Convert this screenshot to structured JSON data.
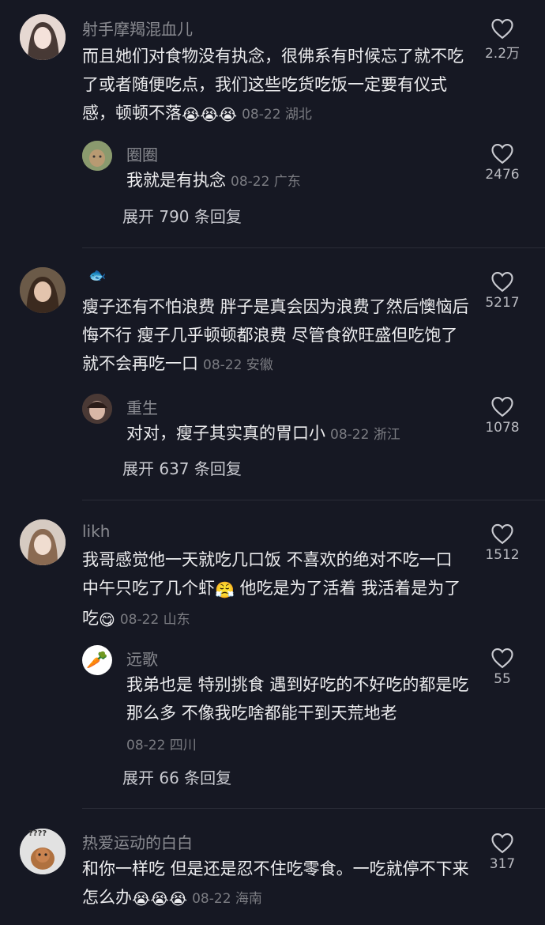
{
  "threads": [
    {
      "comment": {
        "user": "射手摩羯混血儿",
        "text": "而且她们对食物没有执念，很佛系有时候忘了就不吃了或者随便吃点，我们这些吃货吃饭一定要有仪式感，顿顿不落",
        "emojis": "😭😭😭",
        "meta": "08-22 湖北",
        "likes": "2.2万"
      },
      "reply": {
        "user": "圈圈",
        "text": "我就是有执念",
        "meta": "08-22 广东",
        "likes": "2476"
      },
      "expand": "展开 790 条回复"
    },
    {
      "comment": {
        "user": "",
        "badge": "🐟",
        "text": "瘦子还有不怕浪费 胖子是真会因为浪费了然后懊恼后悔不行  瘦子几乎顿顿都浪费 尽管食欲旺盛但吃饱了就不会再吃一口",
        "meta": "08-22 安徽",
        "likes": "5217"
      },
      "reply": {
        "user": "重生",
        "text": "对对，瘦子其实真的胃口小",
        "meta": "08-22 浙江",
        "likes": "1078"
      },
      "expand": "展开 637 条回复"
    },
    {
      "comment": {
        "user": "likh",
        "text_a": "我哥感觉他一天就吃几口饭 不喜欢的绝对不吃一口 中午只吃了几个虾",
        "emoji_a": "😤",
        "text_b": " 他吃是为了活着 我活着是为了吃",
        "emoji_b": "😋",
        "meta": "08-22 山东",
        "likes": "1512"
      },
      "reply": {
        "user": "远歌",
        "text": "我弟也是 特别挑食 遇到好吃的不好吃的都是吃那么多 不像我吃啥都能干到天荒地老",
        "meta": "08-22 四川",
        "likes": "55",
        "avatar_icon": "🥕"
      },
      "expand": "展开 66 条回复"
    },
    {
      "comment": {
        "user": "热爱运动的白白",
        "text": "和你一样吃 但是还是忍不住吃零食。一吃就停不下来 怎么办",
        "emojis": "😭😭😭",
        "meta": "08-22 海南",
        "likes": "317",
        "avatar_caption": "????"
      }
    }
  ],
  "colors": {
    "background": "#161823",
    "username": "#8a8b91",
    "text": "#ececee",
    "meta": "#7b7c82"
  },
  "icons": {
    "like": "heart-outline-icon"
  }
}
